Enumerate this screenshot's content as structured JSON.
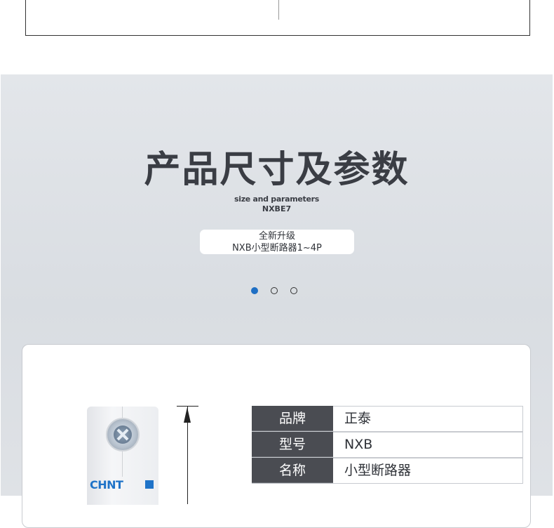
{
  "section": {
    "title": "产品尺寸及参数",
    "subtitle_en": "size and parameters",
    "model_code": "NXBE7",
    "pill": {
      "line1": "全新升级",
      "line2": "NXB小型断路器1~4P"
    },
    "carousel": {
      "count": 3,
      "active_index": 0
    }
  },
  "product": {
    "brand_logo": "CHNT",
    "accent_color": "#1f73c8"
  },
  "params": [
    {
      "key": "品牌",
      "value": "正泰"
    },
    {
      "key": "型号",
      "value": "NXB"
    },
    {
      "key": "名称",
      "value": "小型断路器"
    }
  ],
  "colors": {
    "band_bg": "#dfe2e6",
    "title": "#3a3d44",
    "table_header": "#4a4c52",
    "dot_active": "#1f6fc4"
  }
}
